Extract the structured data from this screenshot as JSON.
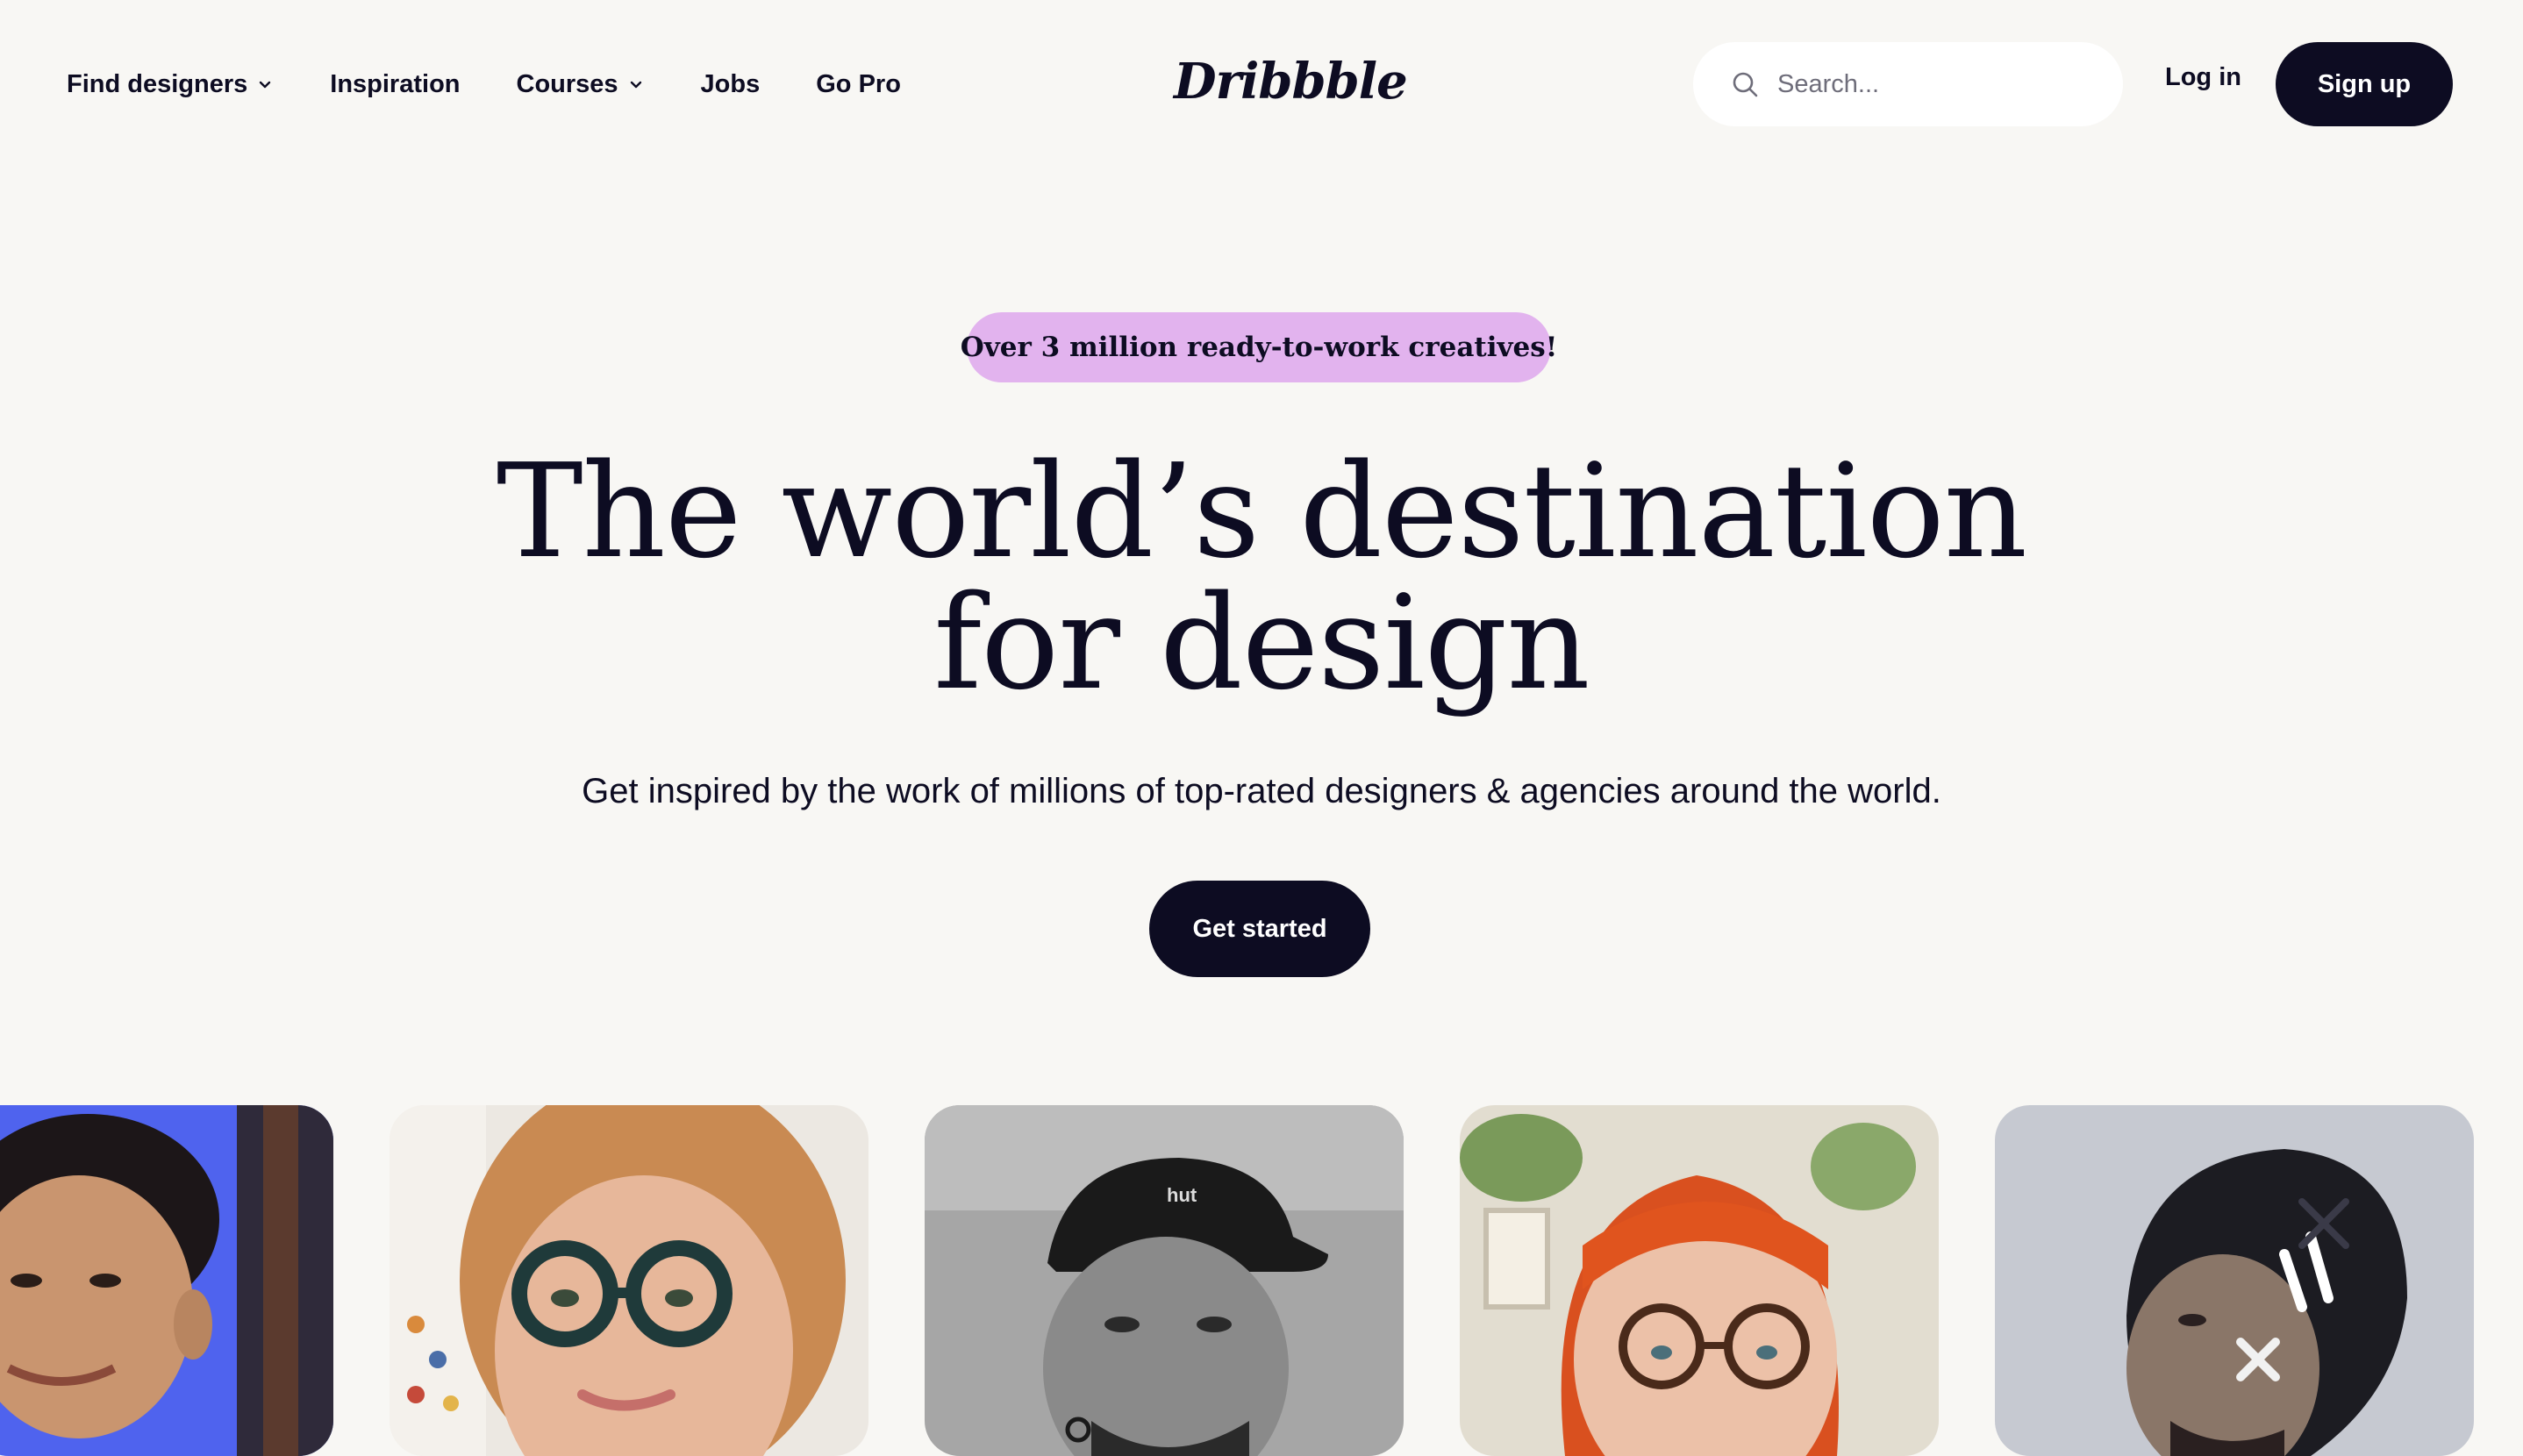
{
  "nav": {
    "links": [
      {
        "label": "Find designers",
        "has_dropdown": true
      },
      {
        "label": "Inspiration",
        "has_dropdown": false
      },
      {
        "label": "Courses",
        "has_dropdown": true
      },
      {
        "label": "Jobs",
        "has_dropdown": false
      },
      {
        "label": "Go Pro",
        "has_dropdown": false
      }
    ],
    "logo": "Dribbble",
    "search": {
      "placeholder": "Search...",
      "value": ""
    },
    "login_label": "Log in",
    "signup_label": "Sign up"
  },
  "hero": {
    "badge": "Over 3 million ready-to-work creatives!",
    "headline_line1": "The world’s destination",
    "headline_line2": "for design",
    "subhead": "Get inspired by the work of millions of top-rated designers & agencies around the world.",
    "cta_label": "Get started"
  },
  "designer_cards": [
    {
      "description": "designer portrait, blue backdrop",
      "background": "#5a6cf0"
    },
    {
      "description": "designer portrait with round glasses",
      "background": "#e8e2dc"
    },
    {
      "description": "black and white portrait, cap",
      "background": "#9a9a9a"
    },
    {
      "description": "designer portrait, red hair",
      "background": "#dcd6c8"
    },
    {
      "description": "portrait with face paint",
      "background": "#c9ccd4"
    }
  ],
  "colors": {
    "background": "#f8f7f4",
    "text": "#0d0c22",
    "badge": "#e2b3ee",
    "button_dark": "#0d0c22"
  }
}
